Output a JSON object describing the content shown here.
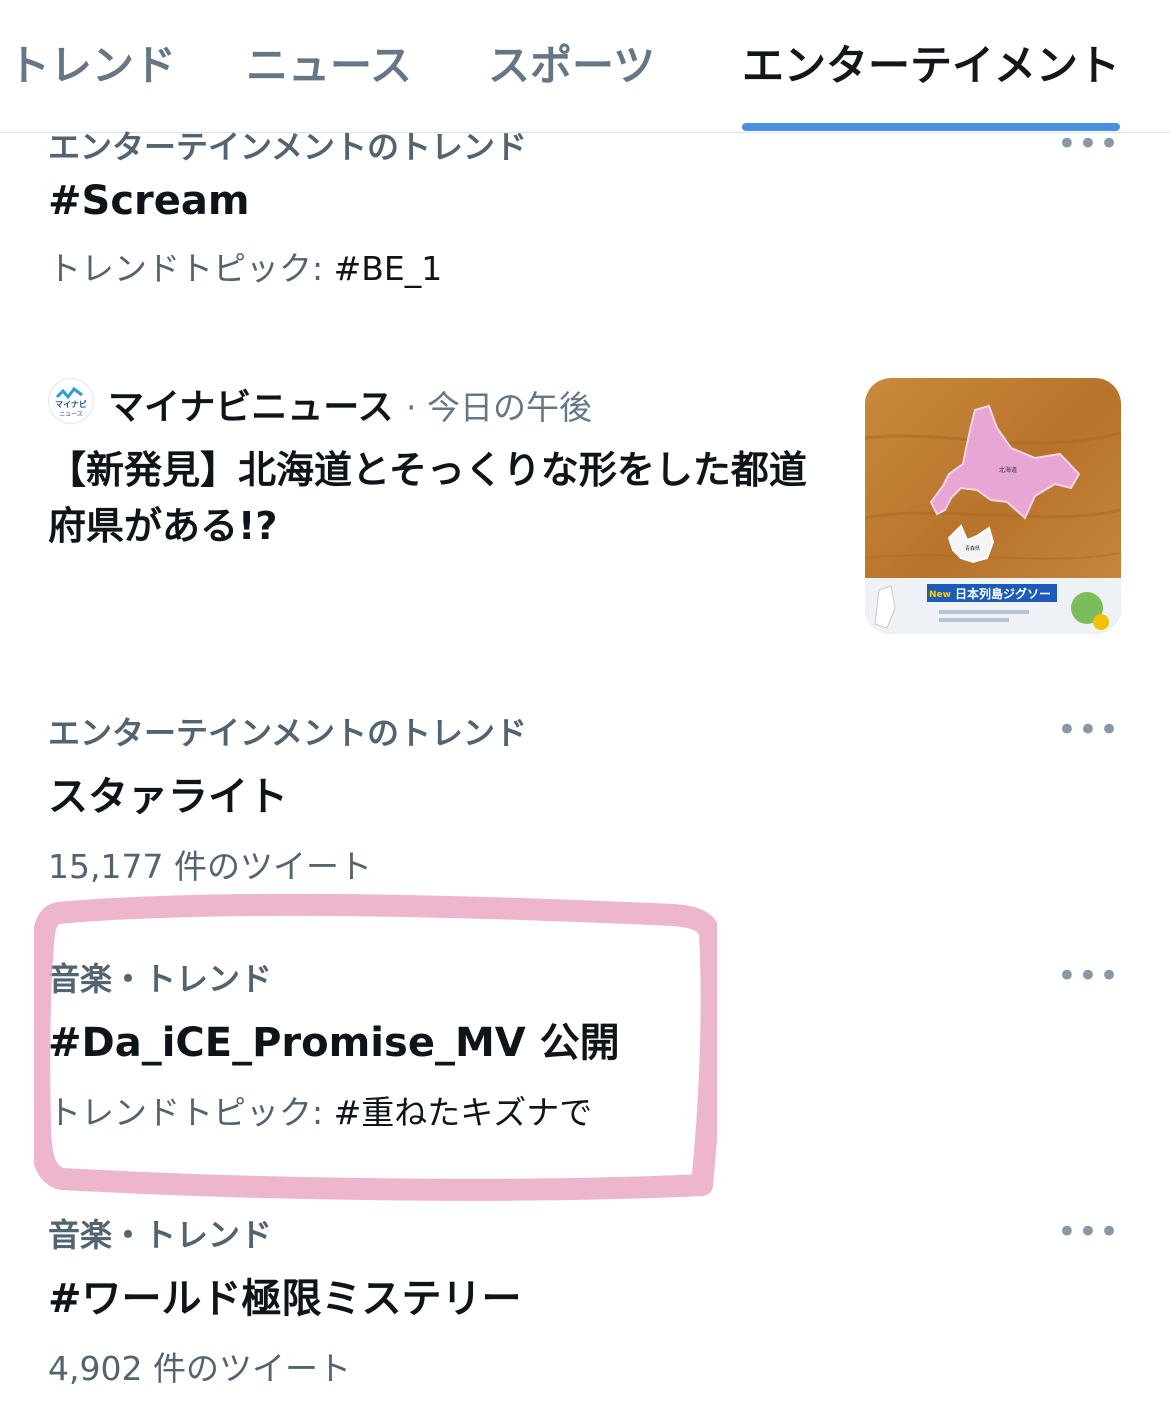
{
  "colors": {
    "accent": "#4a90e2",
    "muted": "#536471",
    "text": "#0f1419",
    "highlight_marker": "#eaa9c4"
  },
  "tabs": [
    {
      "label": "トレンド"
    },
    {
      "label": "ニュース"
    },
    {
      "label": "スポーツ"
    },
    {
      "label": "エンターテイメント"
    }
  ],
  "trends": [
    {
      "category": "エンターテインメントのトレンド",
      "title": "#Scream",
      "subtitle_prefix": "トレンドトピック: ",
      "subtitle_topic": "#BE_1"
    },
    {
      "category": "エンターテインメントのトレンド",
      "title": "スタァライト",
      "subtitle": "15,177 件のツイート"
    },
    {
      "category": "音楽・トレンド",
      "title": "#Da_iCE_Promise_MV 公開",
      "subtitle_prefix": "トレンドトピック: ",
      "subtitle_topic": "#重ねたキズナで"
    },
    {
      "category": "音楽・トレンド",
      "title": "#ワールド極限ミステリー",
      "subtitle": "4,902 件のツイート"
    }
  ],
  "news": {
    "source": "マイナビニュース",
    "time": "· 今日の午後",
    "headline": "【新発見】北海道とそっくりな形をした都道府県がある!?",
    "logo_text": "マイナビ",
    "logo_sub": "ニュース",
    "thumb_banner": "日本列島ジグソー",
    "thumb_new": "New",
    "thumb_label_hokkaido": "北海道",
    "thumb_label_aomori": "青森県"
  },
  "more_glyph": "•••"
}
